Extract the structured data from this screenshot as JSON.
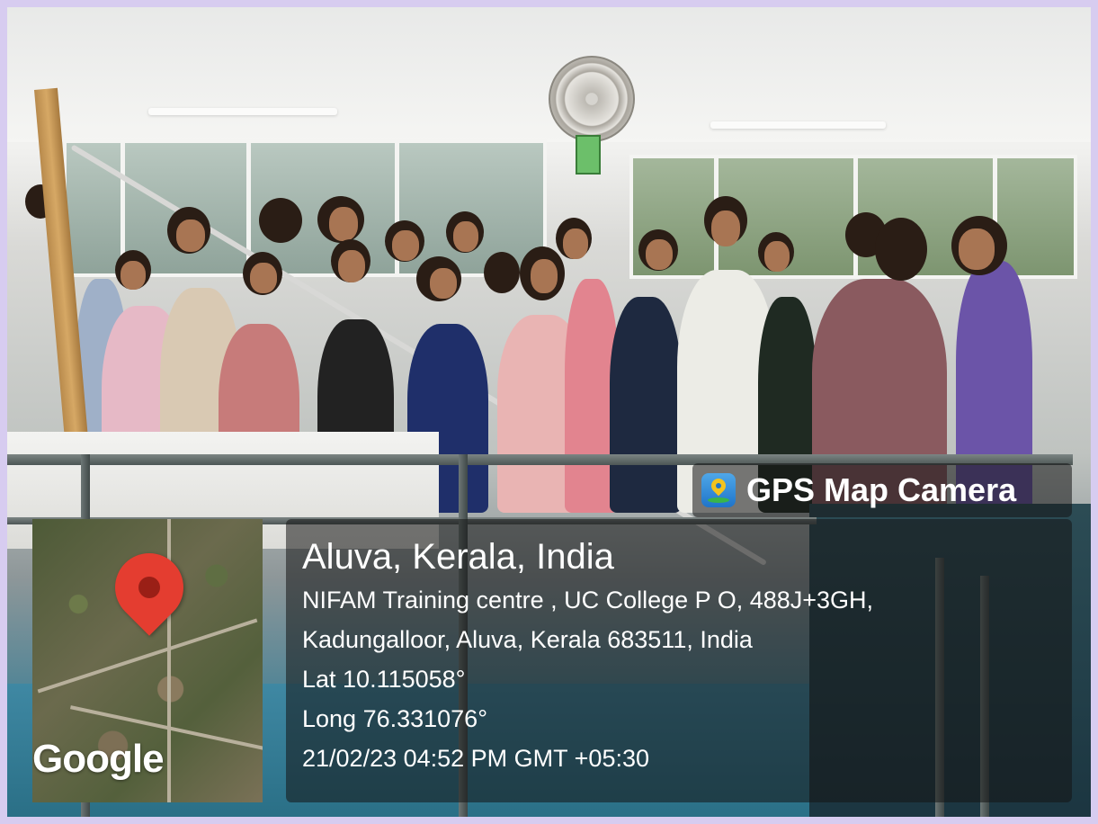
{
  "overlay": {
    "app_name": "GPS Map Camera",
    "app_icon": "gps-map-camera-app-icon",
    "map_pin_icon": "map-pin-icon",
    "map_label": "Google",
    "city": "Aluva, Kerala, India",
    "address_line1": "NIFAM Training centre , UC College P O, 488J+3GH,",
    "address_line2": "Kadungalloor, Aluva, Kerala 683511, India",
    "latitude": "Lat 10.115058°",
    "longitude": "Long 76.331076°",
    "datetime": "21/02/23 04:52 PM GMT +05:30"
  },
  "colors": {
    "pin": "#e43d30",
    "frame": "#d7ccf0",
    "overlay_bg": "rgba(20,20,20,0.55)"
  }
}
